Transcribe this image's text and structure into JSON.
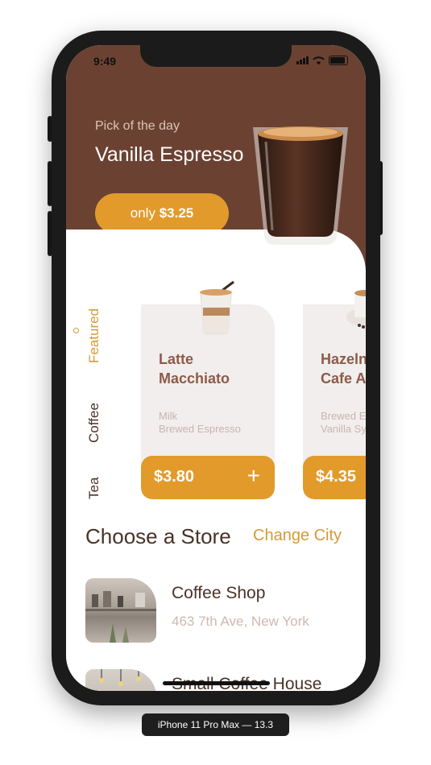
{
  "status_bar": {
    "time": "9:49"
  },
  "hero": {
    "label": "Pick of the day",
    "product_name": "Vanilla Espresso",
    "price_prefix": "only",
    "price": "$3.25"
  },
  "categories": [
    {
      "label": "Featured",
      "active": true
    },
    {
      "label": "Coffee",
      "active": false
    },
    {
      "label": "Tea",
      "active": false
    }
  ],
  "products": [
    {
      "name_line1": "Latte",
      "name_line2": "Macchiato",
      "ingredient1": "Milk",
      "ingredient2": "Brewed Espresso",
      "price": "$3.80",
      "add_label": "+"
    },
    {
      "name_line1": "Hazelnut",
      "name_line2": "Cafe Au Lait",
      "ingredient1": "Brewed Espresso",
      "ingredient2": "Vanilla Syrup",
      "price": "$4.35",
      "add_label": "+"
    }
  ],
  "store_section": {
    "title": "Choose a Store",
    "change_city": "Change City"
  },
  "stores": [
    {
      "name": "Coffee Shop",
      "address": "463 7th Ave, New York"
    },
    {
      "name": "Small Coffee House",
      "address": ""
    }
  ],
  "device_label": "iPhone 11 Pro Max — 13.3",
  "colors": {
    "hero_brown": "#6b4232",
    "accent_orange": "#e29a2b",
    "card_bg": "#f2eeee",
    "text_brown": "#8d5b47"
  }
}
